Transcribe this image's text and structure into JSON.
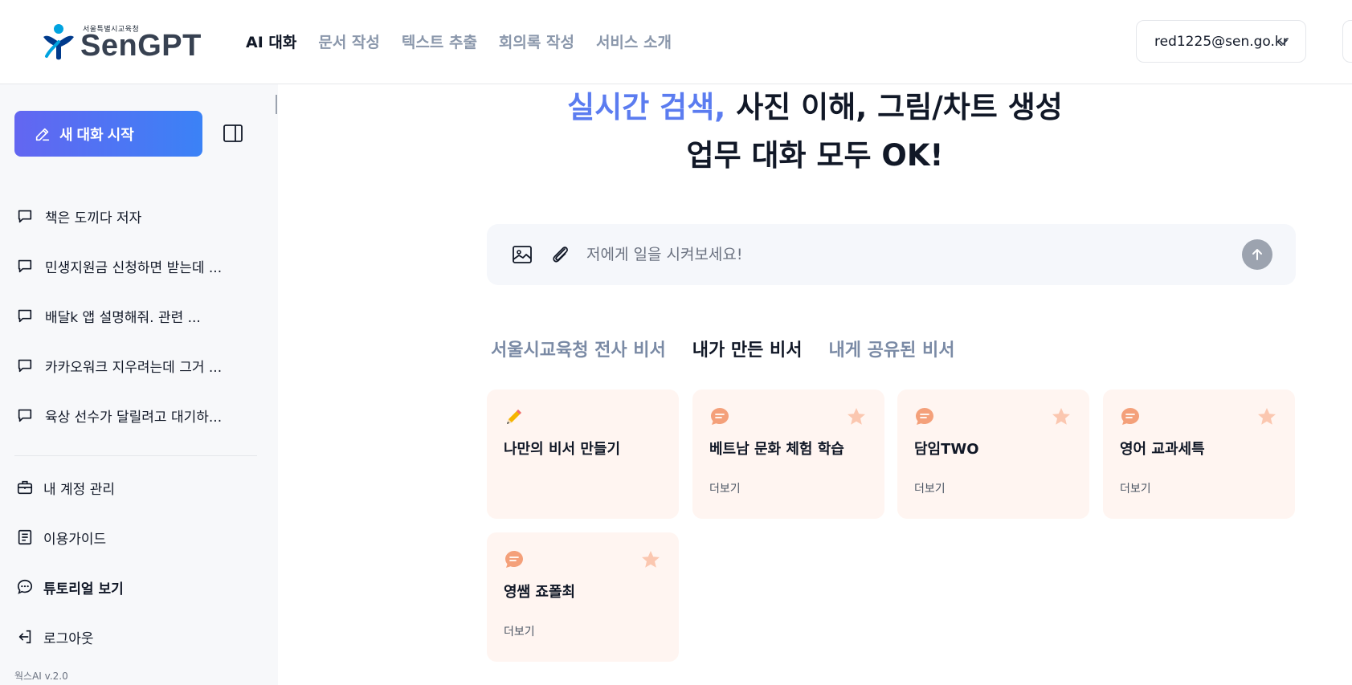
{
  "header": {
    "logo_sub": "서울특별시교육청",
    "logo_main": "SenGPT",
    "nav": [
      "AI 대화",
      "문서 작성",
      "텍스트 추출",
      "회의록 작성",
      "서비스 소개"
    ],
    "account_email": "red1225@sen.go.kr"
  },
  "sidebar": {
    "new_chat_label": "새 대화 시작",
    "history": [
      "책은 도끼다 저자",
      "민생지원금 신청하면 받는데 ...",
      "배달k 앱 설명해줘. 관련 ...",
      "카카오워크 지우려는데 그거 ...",
      "육상 선수가 달릴려고 대기하..."
    ],
    "menu": [
      "내 계정 관리",
      "이용가이드",
      "튜토리얼 보기",
      "로그아웃"
    ],
    "version": "웍스AI v.2.0"
  },
  "main": {
    "hero_accent": "실시간 검색,",
    "hero_rest": " 사진 이해, 그림/차트 생성",
    "hero_line2": "업무 대화 모두 OK!",
    "composer_placeholder": "저에게 일을 시켜보세요!",
    "tabs": [
      "서울시교육청 전사 비서",
      "내가 만든 비서",
      "내게 공유된 비서"
    ],
    "cards": [
      {
        "title": "나만의 비서 만들기",
        "more": ""
      },
      {
        "title": "베트남 문화 체험 학습",
        "more": "더보기"
      },
      {
        "title": "담임TWO",
        "more": "더보기"
      },
      {
        "title": "영어 교과세특",
        "more": "더보기"
      },
      {
        "title": "영쌤 죠폴최",
        "more": "더보기"
      }
    ]
  },
  "colors": {
    "accent": "#5b7cf0",
    "button_gradient_start": "#6366f1",
    "button_gradient_end": "#3b82f6",
    "card_bg": "#fff5f1",
    "card_icon": "#f4a07a"
  }
}
